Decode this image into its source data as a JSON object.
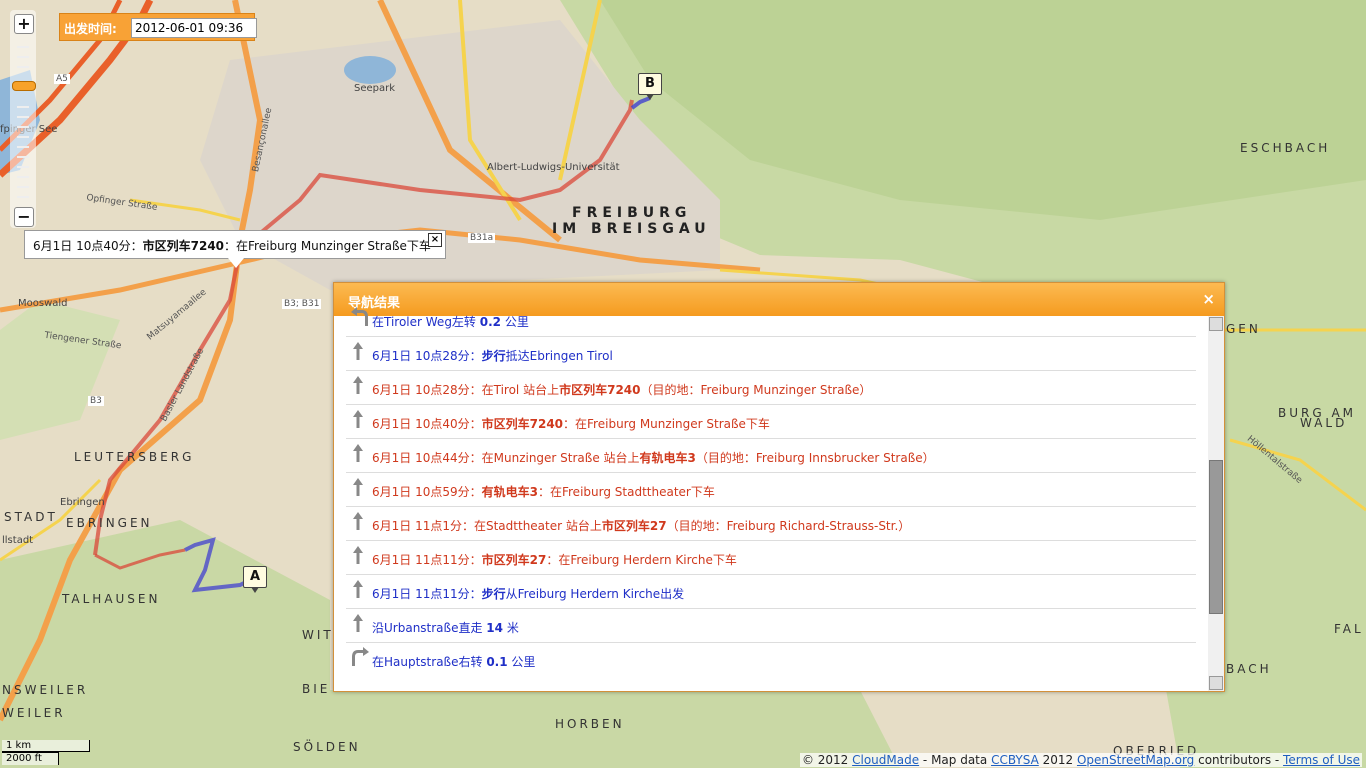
{
  "departure": {
    "label": "出发时间:",
    "value": "2012-06-01 09:36"
  },
  "zoom": {
    "plus": "+",
    "minus": "−"
  },
  "popup": {
    "time": "6月1日 10点40分：",
    "line": "市区列车7240",
    "rest": "：在Freiburg Munzinger Straße下车",
    "close": "×"
  },
  "markers": {
    "a": "A",
    "b": "B"
  },
  "places": {
    "freiburg1": "FREIBURG",
    "freiburg2": "IM BREISGAU",
    "eschbach": "ESCHBACH",
    "leutersberg": "LEUTERSBERG",
    "ebringen": "EBRINGEN",
    "stadt": "STADT",
    "talhausen": "TALHAUSEN",
    "nsweiler": "NSWEILER",
    "weiler": "WEILER",
    "horben": "HORBEN",
    "solden": "SÖLDEN",
    "burg": "BURG AM",
    "wald": "WALD",
    "gen": "GEN",
    "fal": "FAL",
    "bach": "BACH",
    "wit": "WIT",
    "bie": "BIE",
    "oberried": "OBERRIED",
    "seepark": "Seepark",
    "uni": "Albert-Ludwigs-Universität",
    "mooswald": "Mooswald",
    "see": "fpinger See",
    "ebringen_small": "Ebringen",
    "allstadt": "llstadt",
    "opfinger": "Opfinger Straße",
    "tiengener": "Tiengener Straße",
    "besancon": "Besançonallee",
    "matsuyama": "Matsuyamaallee",
    "baslerland": "Basler Landstraße",
    "hollental": "Höllentalstraße",
    "a5": "A5",
    "b3": "B3",
    "b3b31": "B3; B31",
    "b31a": "B31a"
  },
  "nav": {
    "title": "导航结果",
    "close": "×",
    "steps": [
      {
        "icon": "turn-left-icon",
        "color": "blue",
        "parts": [
          "在Tiroler Weg左转 ",
          "0.2",
          " 公里"
        ]
      },
      {
        "icon": "straight-icon",
        "color": "blue",
        "parts": [
          "6月1日 10点28分：",
          "步行",
          "抵达Ebringen Tirol"
        ]
      },
      {
        "icon": "straight-icon",
        "color": "red",
        "parts": [
          "6月1日 10点28分：在Tirol 站台上",
          "市区列车7240",
          "（目的地：Freiburg Munzinger Straße）"
        ]
      },
      {
        "icon": "straight-icon",
        "color": "red",
        "parts": [
          "6月1日 10点40分：",
          "市区列车7240",
          "：在Freiburg Munzinger Straße下车"
        ]
      },
      {
        "icon": "straight-icon",
        "color": "red",
        "parts": [
          "6月1日 10点44分：在Munzinger Straße 站台上",
          "有轨电车3",
          "（目的地：Freiburg Innsbrucker Straße）"
        ]
      },
      {
        "icon": "straight-icon",
        "color": "red",
        "parts": [
          "6月1日 10点59分：",
          "有轨电车3",
          "：在Freiburg Stadttheater下车"
        ]
      },
      {
        "icon": "straight-icon",
        "color": "red",
        "parts": [
          "6月1日 11点1分：在Stadttheater 站台上",
          "市区列车27",
          "（目的地：Freiburg Richard-Strauss-Str.）"
        ]
      },
      {
        "icon": "straight-icon",
        "color": "red",
        "parts": [
          "6月1日 11点11分：",
          "市区列车27",
          "：在Freiburg Herdern Kirche下车"
        ]
      },
      {
        "icon": "straight-icon",
        "color": "blue",
        "parts": [
          "6月1日 11点11分：",
          "步行",
          "从Freiburg Herdern Kirche出发"
        ]
      },
      {
        "icon": "straight-icon",
        "color": "blue",
        "parts": [
          "沿Urbanstraße直走 ",
          "14",
          " 米"
        ]
      },
      {
        "icon": "turn-right-icon",
        "color": "blue",
        "parts": [
          "在Hauptstraße右转 ",
          "0.1",
          " 公里"
        ]
      }
    ]
  },
  "scale": {
    "km": "1 km",
    "ft": "2000 ft"
  },
  "attribution": {
    "pre": "© 2012 ",
    "cloudmade": "CloudMade",
    "mid1": " - Map data ",
    "ccbysa": "CCBYSA",
    "mid2": " 2012 ",
    "osm": "OpenStreetMap.org",
    "mid3": " contributors - ",
    "terms": "Terms of Use"
  }
}
